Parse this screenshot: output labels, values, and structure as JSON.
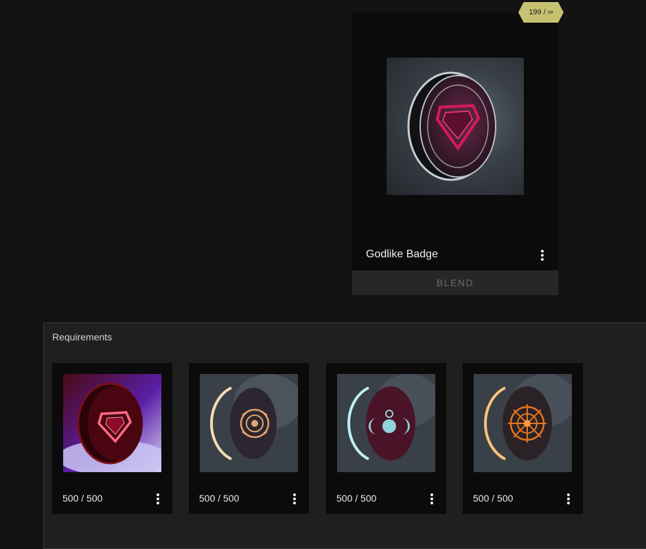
{
  "main_item": {
    "title": "Godlike Badge",
    "count_badge": "199 / ∞",
    "action_label": "BLEND",
    "icon": "godlike-gem-badge-icon"
  },
  "requirements": {
    "title": "Requirements",
    "items": [
      {
        "count": "500 / 500",
        "icon": "red-gem-badge-icon"
      },
      {
        "count": "500 / 500",
        "icon": "orange-eye-badge-icon"
      },
      {
        "count": "500 / 500",
        "icon": "cyan-moon-badge-icon"
      },
      {
        "count": "500 / 500",
        "icon": "orange-sun-badge-icon"
      }
    ]
  },
  "colors": {
    "background": "#131313",
    "card": "#0b0b0b",
    "panel": "#1f1f1f",
    "badge": "#c7c272"
  }
}
